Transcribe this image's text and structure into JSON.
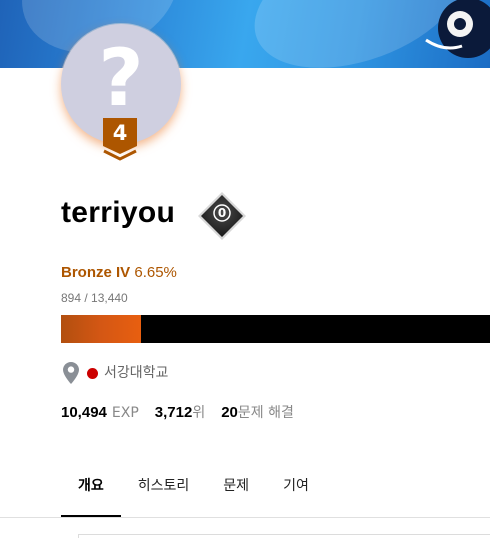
{
  "profile": {
    "username": "terriyou",
    "avatar_glyph": "?",
    "tier_badge_number": "4",
    "class_badge_number": "0"
  },
  "tier": {
    "name": "Bronze IV",
    "percent": "6.65%",
    "rating_text": "894 / 13,440",
    "progress_fraction": 0.1865,
    "color": "#ad5600"
  },
  "organization": {
    "icon": "location-pin-icon",
    "school_name": "서강대학교",
    "dot_color": "#cc0000"
  },
  "stats": {
    "exp_value": "10,494",
    "exp_unit": "EXP",
    "rank_value": "3,712",
    "rank_unit": "위",
    "solved_value": "20",
    "solved_unit": "문제 해결"
  },
  "tabs": [
    {
      "label": "개요",
      "active": true
    },
    {
      "label": "히스토리",
      "active": false
    },
    {
      "label": "문제",
      "active": false
    },
    {
      "label": "기여",
      "active": false
    }
  ]
}
